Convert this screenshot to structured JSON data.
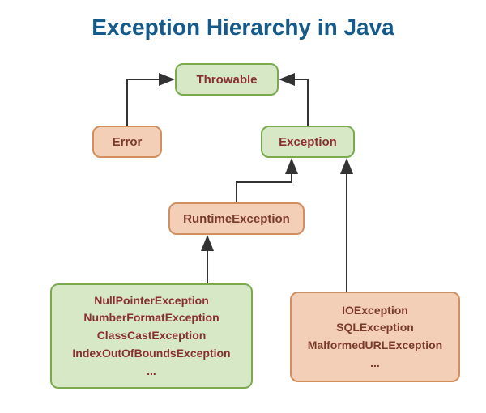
{
  "title": "Exception Hierarchy in Java",
  "nodes": {
    "throwable": "Throwable",
    "error": "Error",
    "exception": "Exception",
    "runtimeException": "RuntimeException"
  },
  "runtimeChildren": {
    "l1": "NullPointerException",
    "l2": "NumberFormatException",
    "l3": "ClassCastException",
    "l4": "IndexOutOfBoundsException",
    "l5": "..."
  },
  "checkedChildren": {
    "l1": "IOException",
    "l2": "SQLException",
    "l3": "MalformedURLException",
    "l4": "..."
  }
}
